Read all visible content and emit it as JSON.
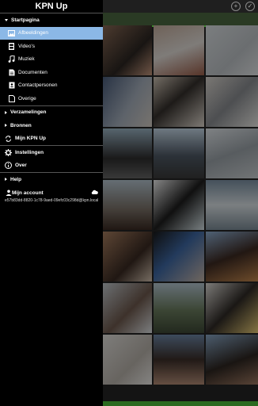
{
  "app": {
    "title": "KPN Up"
  },
  "drawer": {
    "startpagina": "Startpagina",
    "media_items": [
      {
        "label": "Afbeeldingen",
        "icon": "image-icon",
        "selected": true
      },
      {
        "label": "Video's",
        "icon": "film-icon",
        "selected": false
      },
      {
        "label": "Muziek",
        "icon": "music-icon",
        "selected": false
      },
      {
        "label": "Documenten",
        "icon": "document-icon",
        "selected": false
      },
      {
        "label": "Contactpersonen",
        "icon": "contacts-icon",
        "selected": false
      },
      {
        "label": "Overige",
        "icon": "file-icon",
        "selected": false
      }
    ],
    "verzamelingen": "Verzamelingen",
    "bronnen": "Bronnen",
    "mijn_kpn_up": "Mijn KPN Up",
    "instellingen": "Instellingen",
    "over": "Over",
    "help": "Help",
    "account_label": "Mijn account",
    "account_id": "e57b83dd-8820-1c78-9aed-09efc03c298d@kpn.local"
  }
}
